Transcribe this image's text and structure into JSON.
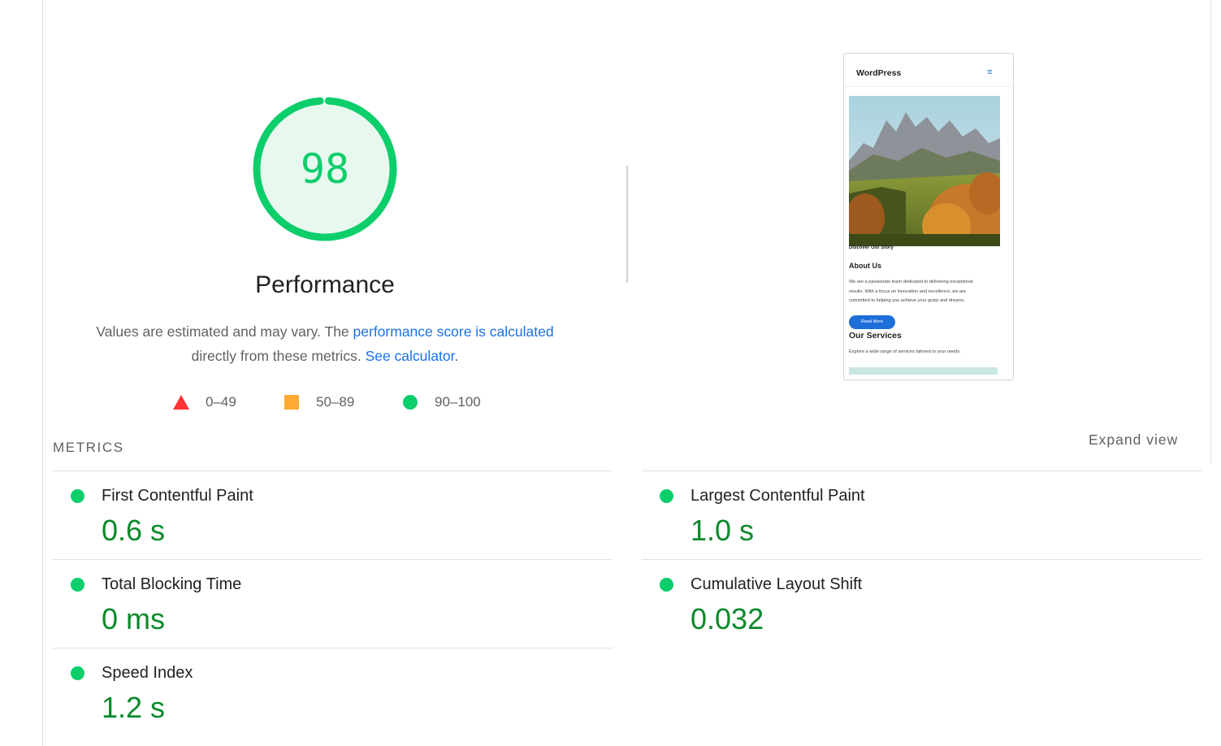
{
  "score": {
    "value": "98",
    "fraction": 0.98,
    "title": "Performance",
    "color": "#0cce6b",
    "bg_color": "#e8f8ef"
  },
  "description": {
    "prefix": "Values are estimated and may vary. The ",
    "link1": "performance score is calculated",
    "middle": "directly from these metrics. ",
    "link2": "See calculator",
    "suffix": "."
  },
  "legend": [
    {
      "shape": "triangle",
      "color": "#ff3333",
      "label": "0–49"
    },
    {
      "shape": "square",
      "color": "#ffaa33",
      "label": "50–89"
    },
    {
      "shape": "circle",
      "color": "#0cce6b",
      "label": "90–100"
    }
  ],
  "thumbnail": {
    "brand": "WordPress",
    "menu_icon": "hamburger-icon",
    "caption": "Discover Our Story",
    "heading": "About Us",
    "paragraph_lines": [
      "We are a passionate team dedicated to delivering exceptional",
      "results. With a focus on innovation and excellence, we are",
      "committed to helping you achieve your goals and dreams."
    ],
    "button": "Read More",
    "heading2": "Our Services",
    "paragraph2": "Explore a wide range of services tailored to your needs."
  },
  "expand_label": "Expand view",
  "metrics_title": "METRICS",
  "metrics": [
    {
      "label": "First Contentful Paint",
      "value": "0.6 s",
      "status": "pass"
    },
    {
      "label": "Largest Contentful Paint",
      "value": "1.0 s",
      "status": "pass"
    },
    {
      "label": "Total Blocking Time",
      "value": "0 ms",
      "status": "pass"
    },
    {
      "label": "Cumulative Layout Shift",
      "value": "0.032",
      "status": "pass"
    },
    {
      "label": "Speed Index",
      "value": "1.2 s",
      "status": "pass"
    }
  ]
}
